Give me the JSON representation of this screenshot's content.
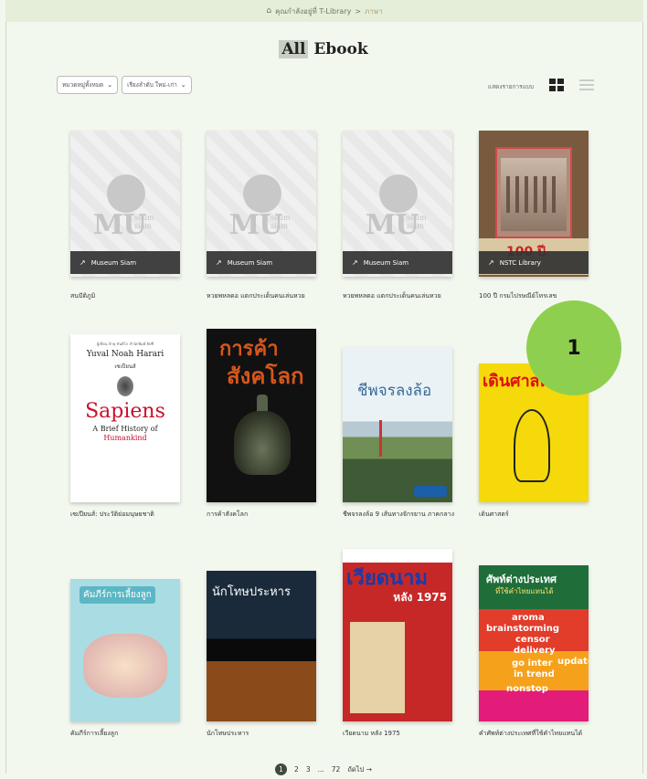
{
  "breadcrumb": {
    "home": "คุณกำลังอยู่ที่ T-Library",
    "sep": ">",
    "current": "ภาษา"
  },
  "page": {
    "title_hl": "All",
    "title_rest": "Ebook"
  },
  "filters": {
    "category": "หมวดหมู่ทั้งหมด",
    "sort": "เรียงลำดับ ใหม่-เก่า"
  },
  "view": {
    "label": "แสดงรายการแบบ"
  },
  "ribbons": {
    "museum": "Museum Siam",
    "nstc": "NSTC Library"
  },
  "books": [
    {
      "title": "สนปัติภูมิ"
    },
    {
      "title": "หวยพหลดอ แตกประเด็นคนเล่นหวย"
    },
    {
      "title": "หวยพหลดอ แตกประเด็นคนเล่นหวย"
    },
    {
      "title": "100 ปี กรมไปรษณีย์โทรเลข"
    },
    {
      "title": "เซเปียนส์: ประวัติย่อมนุษยชาติ"
    },
    {
      "title": "การค้าสังคโลก"
    },
    {
      "title": "ชีพจรลงล้อ 9 เส้นทางจักรยาน ภาคกลาง"
    },
    {
      "title": "เดินศาสตร์"
    },
    {
      "title": "คัมภีร์การเลี้ยงลูก"
    },
    {
      "title": "นักโทษประหาร"
    },
    {
      "title": "เวียดนาม หลัง 1975"
    },
    {
      "title": "คำศัพท์ต่างประเทศที่ใช้คำไทยแทนได้"
    }
  ],
  "covers": {
    "museum_mu": "MU",
    "museum_seum": "seum\nsiam",
    "c100_label": "100 ปี",
    "sapiens_small": "ผู้เขียน ภิกษุ ขันติโก สำนักพิมพ์ ยิปซี",
    "sapiens_author": "Yuval Noah Harari",
    "sapiens_th": "เซเปียนส์",
    "sapiens_title": "Sapiens",
    "sapiens_sub": "A Brief History of",
    "sapiens_sub2": "Humankind",
    "trade_1": "การค้า",
    "trade_2": "สังคโลก",
    "river_title": "ชีพจรลงล้อ",
    "walk_title": "เดินศาสตร์",
    "parent_title": "คัมภีร์การเลี้ยงลูก",
    "lawyer_title": "นักโทษประหาร",
    "vietnam_title": "เวียดนาม",
    "vietnam_year": "หลัง 1975",
    "vocab_title": "ศัพท์ต่างประเทศ",
    "vocab_sub": "ที่ใช้คำไทยแทนได้",
    "vocab_words": [
      "aroma",
      "brainstorming",
      "censor",
      "delivery",
      "go inter",
      "in trend",
      "nonstop",
      "update"
    ]
  },
  "badge": {
    "label": "1"
  },
  "pagination": {
    "p1": "1",
    "p2": "2",
    "p3": "3",
    "ellipsis": "...",
    "last": "72",
    "next": "ถัดไป →"
  }
}
